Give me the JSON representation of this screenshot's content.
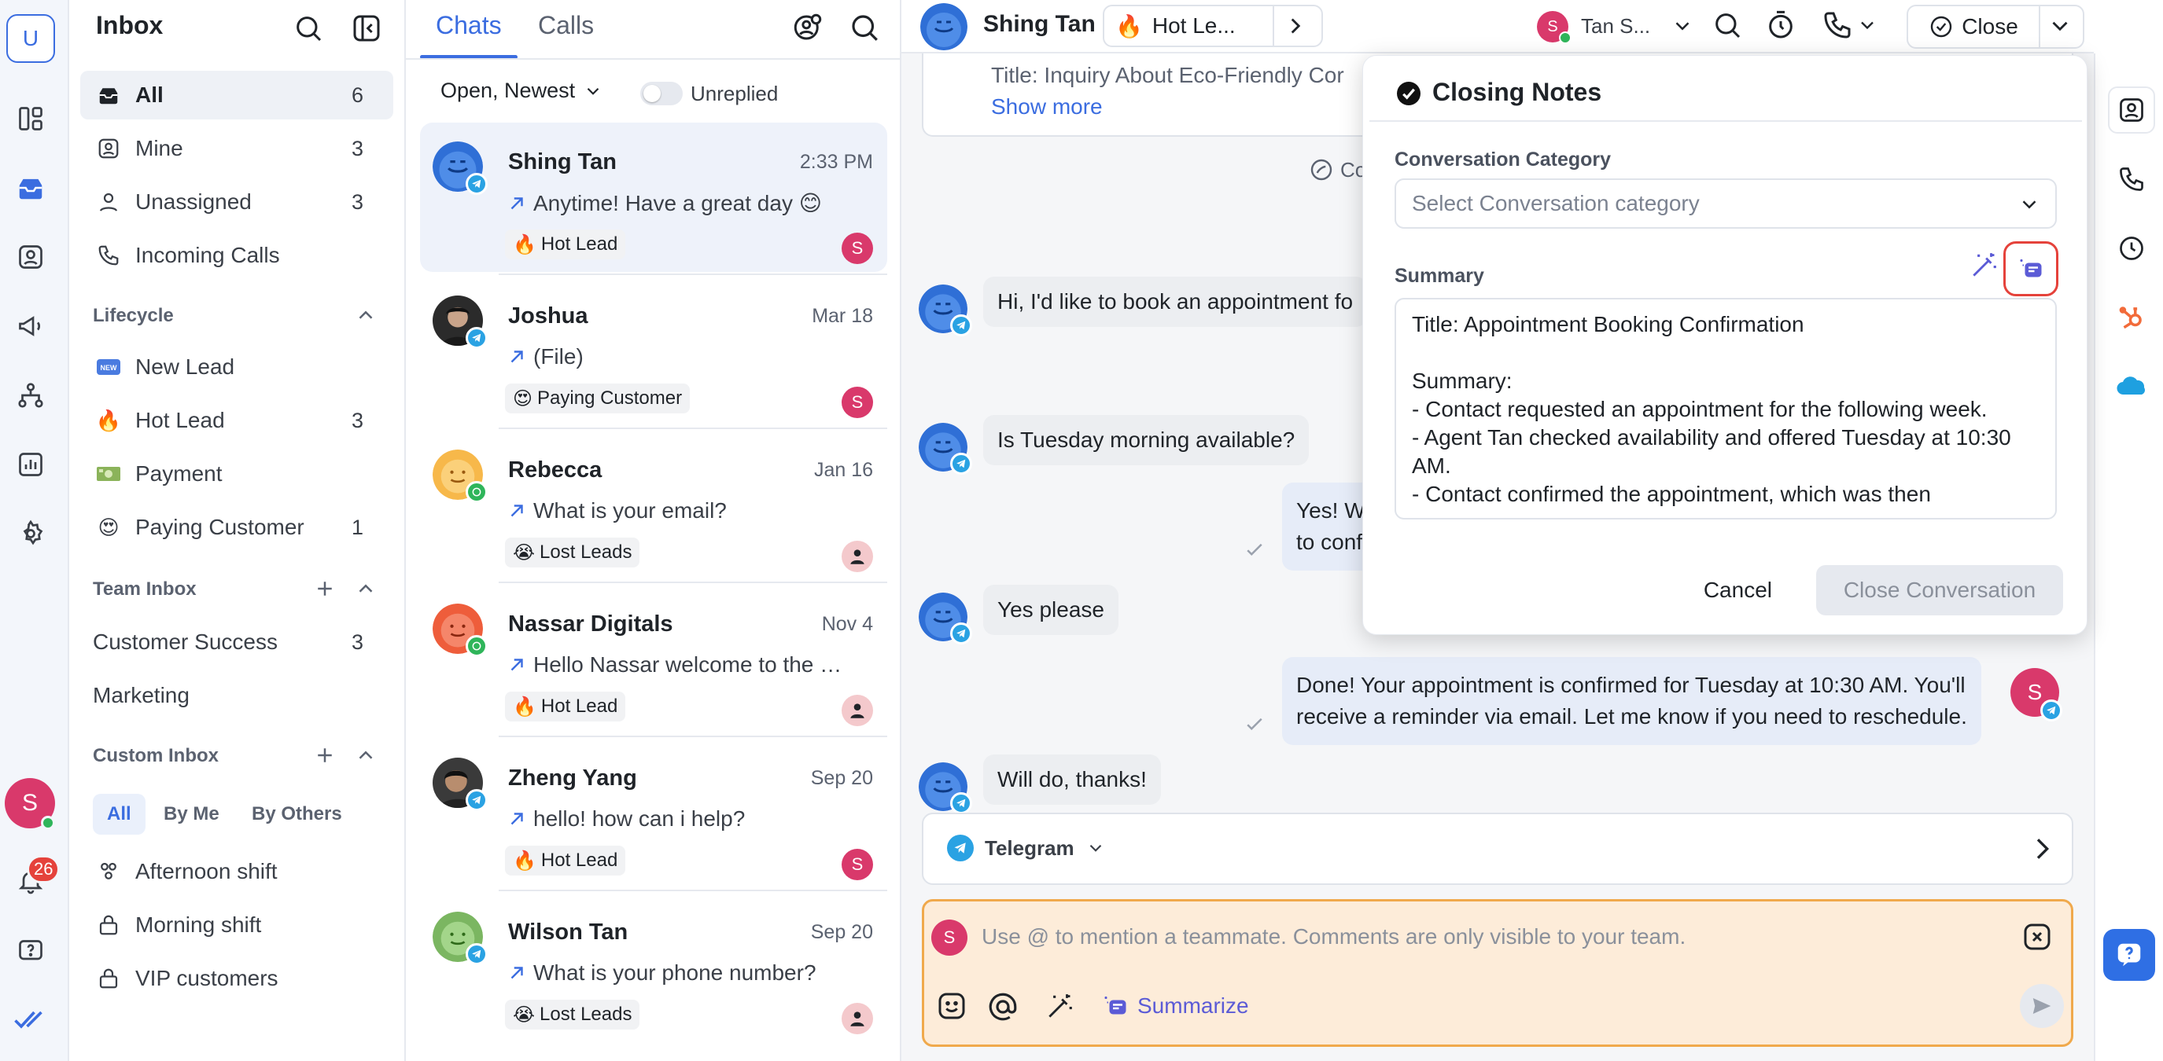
{
  "rail": {
    "logo_letter": "U",
    "user_initial": "S",
    "notification_count": "26"
  },
  "inbox": {
    "title": "Inbox",
    "items": [
      {
        "label": "All",
        "count": "6"
      },
      {
        "label": "Mine",
        "count": "3"
      },
      {
        "label": "Unassigned",
        "count": "3"
      },
      {
        "label": "Incoming Calls",
        "count": ""
      }
    ],
    "lifecycle_label": "Lifecycle",
    "lifecycle": [
      {
        "icon": "new-badge",
        "label": "New Lead",
        "count": ""
      },
      {
        "icon": "fire",
        "label": "Hot Lead",
        "count": "3"
      },
      {
        "icon": "money",
        "label": "Payment",
        "count": ""
      },
      {
        "icon": "heart-eyes",
        "label": "Paying Customer",
        "count": "1"
      }
    ],
    "team_inbox_label": "Team Inbox",
    "team": [
      {
        "label": "Customer Success",
        "count": "3"
      },
      {
        "label": "Marketing",
        "count": ""
      }
    ],
    "custom_inbox_label": "Custom Inbox",
    "custom_filters": [
      "All",
      "By Me",
      "By Others"
    ],
    "custom": [
      {
        "label": "Afternoon shift",
        "icon": "people"
      },
      {
        "label": "Morning shift",
        "icon": "lock"
      },
      {
        "label": "VIP customers",
        "icon": "lock"
      }
    ]
  },
  "chatlist": {
    "tabs": [
      "Chats",
      "Calls"
    ],
    "filter": "Open, Newest",
    "toggle_label": "Unreplied",
    "chats": [
      {
        "name": "Shing Tan",
        "time": "2:33 PM",
        "preview": "Anytime! Have a great day 😊",
        "tag_emoji": "🔥",
        "tag": "Hot Lead",
        "channel": "telegram",
        "assignee": "S",
        "assignee_color": "#d9396b"
      },
      {
        "name": "Joshua",
        "time": "Mar 18",
        "preview": "(File)",
        "tag_emoji": "😍",
        "tag": "Paying Customer",
        "channel": "telegram",
        "assignee": "S",
        "assignee_color": "#d9396b"
      },
      {
        "name": "Rebecca",
        "time": "Jan 16",
        "preview": "What is your email?",
        "tag_emoji": "😭",
        "tag": "Lost Leads",
        "channel": "whatsapp",
        "assignee": "",
        "assignee_color": "#f4c9cc"
      },
      {
        "name": "Nassar Digitals",
        "time": "Nov 4",
        "preview": "Hello Nassar welcome to the ch...",
        "tag_emoji": "🔥",
        "tag": "Hot Lead",
        "channel": "whatsapp",
        "assignee": "",
        "assignee_color": "#f4c9cc"
      },
      {
        "name": "Zheng Yang",
        "time": "Sep 20",
        "preview": "hello! how can i help?",
        "tag_emoji": "🔥",
        "tag": "Hot Lead",
        "channel": "telegram",
        "assignee": "S",
        "assignee_color": "#d9396b"
      },
      {
        "name": "Wilson Tan",
        "time": "Sep 20",
        "preview": "What is your phone number?",
        "tag_emoji": "😭",
        "tag": "Lost Leads",
        "channel": "telegram",
        "assignee": "",
        "assignee_color": "#f4c9cc"
      }
    ]
  },
  "conversation": {
    "contact_name": "Shing Tan",
    "lifecycle": "Hot Le...",
    "agent": "Tan S...",
    "agent_initial": "S",
    "close_label": "Close",
    "context_title": "Title: Inquiry About Eco-Friendly Cor",
    "show_more": "Show more",
    "messages": [
      {
        "dir": "in",
        "text": "Hi, I'd like to book an appointment fo"
      },
      {
        "dir": "in",
        "text": "Is Tuesday morning available?"
      },
      {
        "dir": "out",
        "text": "Yes! We h\nto confirm"
      },
      {
        "dir": "in",
        "text": "Yes please"
      },
      {
        "dir": "out",
        "text": "Done! Your appointment is confirmed for Tuesday at 10:30 AM. You'll\nreceive a reminder via email. Let me know if you need to reschedule."
      },
      {
        "dir": "in",
        "text": "Will do, thanks!"
      }
    ],
    "channel_label": "Telegram",
    "compose_placeholder": "Use @ to mention a teammate. Comments are only visible to your team.",
    "summarize_label": "Summarize",
    "compose_initial": "S"
  },
  "modal": {
    "title": "Closing Notes",
    "category_label": "Conversation Category",
    "category_placeholder": "Select Conversation category",
    "summary_label": "Summary",
    "summary_text": "Title: Appointment Booking Confirmation\n\nSummary:\n- Contact requested an appointment for the following week.\n- Agent Tan checked availability and offered Tuesday at 10:30 AM.\n- Contact confirmed the appointment, which was then",
    "cancel_label": "Cancel",
    "close_conversation_label": "Close Conversation"
  },
  "colors": {
    "accent": "#3b6de0",
    "compose_bg": "#fdecd9",
    "compose_border": "#f0a94c",
    "highlight_ring": "#e5423b"
  }
}
